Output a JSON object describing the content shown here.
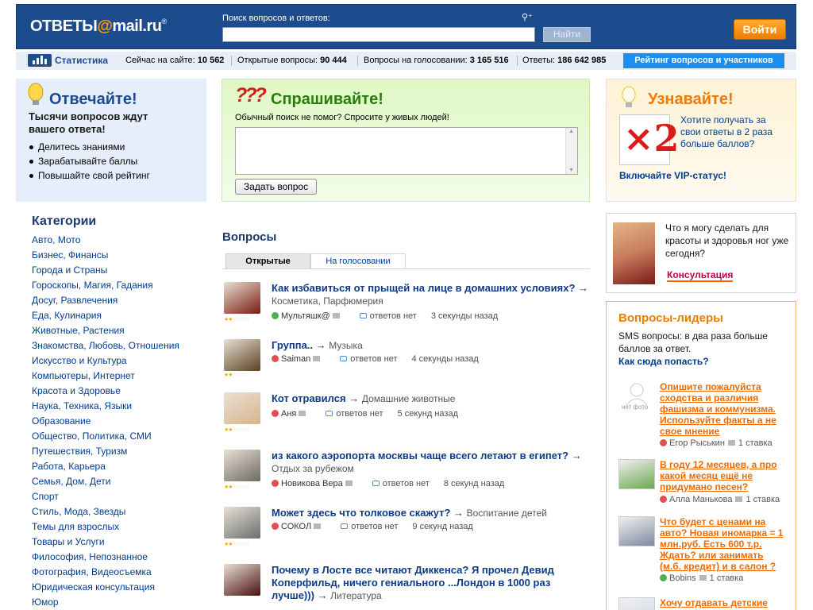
{
  "header": {
    "logo_main": "ОТВЕТЫ",
    "logo_at": "@",
    "logo_mail": "mail.ru",
    "logo_reg": "®",
    "search_label": "Поиск вопросов и ответов:",
    "search_value": "",
    "search_button": "Найти",
    "login_button": "Войти",
    "search_tools_glyph": "⚲⁺"
  },
  "stats": {
    "title": "Статистика",
    "online_label": "Сейчас на сайте:",
    "online_value": "10 562",
    "open_label": "Открытые вопросы:",
    "open_value": "90 444",
    "voting_label": "Вопросы на голосовании:",
    "voting_value": "3 165 516",
    "answers_label": "Ответы:",
    "answers_value": "186 642 985",
    "rating_prefix": "Рейтинг",
    "rating_questions": "вопросов",
    "rating_and": "и",
    "rating_users": "участников"
  },
  "promo_answer": {
    "title": "Отвечайте!",
    "subtitle": "Тысячи вопросов ждут вашего ответа!",
    "items": [
      "Делитесь знаниями",
      "Зарабатывайте баллы",
      "Повышайте свой рейтинг"
    ]
  },
  "promo_ask": {
    "title": "Спрашивайте!",
    "icon_glyph": "???",
    "subtitle": "Обычный поиск не помог? Спросите у живых людей!",
    "textarea_value": "",
    "button": "Задать вопрос"
  },
  "promo_learn": {
    "title": "Узнавайте!",
    "x2_glyph": "×2",
    "link": "Хотите получать за свои ответы в 2 раза больше баллов?",
    "vip_link": "Включайте VIP-статус!"
  },
  "categories": {
    "title": "Категории",
    "items": [
      "Авто, Мото",
      "Бизнес, Финансы",
      "Города и Страны",
      "Гороскопы, Магия, Гадания",
      "Досуг, Развлечения",
      "Еда, Кулинария",
      "Животные, Растения",
      "Знакомства, Любовь, Отношения",
      "Искусство и Культура",
      "Компьютеры, Интернет",
      "Красота и Здоровье",
      "Наука, Техника, Языки",
      "Образование",
      "Общество, Политика, СМИ",
      "Путешествия, Туризм",
      "Работа, Карьера",
      "Семья, Дом, Дети",
      "Спорт",
      "Стиль, Мода, Звезды",
      "Темы для взрослых",
      "Товары и Услуги",
      "Философия, Непознанное",
      "Фотография, Видеосъемка",
      "Юридическая консультация",
      "Юмор"
    ]
  },
  "questions": {
    "title": "Вопросы",
    "tab_open": "Открытые",
    "tab_voting": "На голосовании",
    "arrow": "→",
    "items": [
      {
        "text": "Как избавиться от прыщей на лице в домашних условиях?",
        "category": "Косметика, Парфюмерия",
        "user": "Мультяшк@",
        "answers": "ответов нет",
        "time": "3 секунды назад",
        "stars": "★★☆☆☆☆",
        "user_color": "#4caf50",
        "avatar_color": "#7a1a10"
      },
      {
        "text": "Группа..",
        "category": "Музыка",
        "user": "Saiman",
        "answers": "ответов нет",
        "time": "4 секунды назад",
        "stars": "★★☆☆☆☆",
        "user_color": "#e05050",
        "avatar_color": "#5a4020"
      },
      {
        "text": "Кот отравился",
        "category": "Домашние животные",
        "user": "Аня",
        "answers": "ответов нет",
        "time": "5 секунд назад",
        "stars": "★★☆☆☆☆",
        "user_color": "#e05050",
        "avatar_color": "#d8b48c"
      },
      {
        "text": "из какого аэропорта москвы чаще всего летают в египет?",
        "category": "Отдых за рубежом",
        "user": "Новикова Вера",
        "answers": "ответов нет",
        "time": "8 секунд назад",
        "stars": "★★☆☆☆☆",
        "user_color": "#e05050",
        "avatar_color": "#6d6a64"
      },
      {
        "text": "Может здесь что толковое скажут?",
        "category": "Воспитание детей",
        "user": "СОКОЛ",
        "answers": "ответов нет",
        "time": "9 секунд назад",
        "stars": "★★☆☆☆☆",
        "user_color": "#e05050",
        "avatar_color": "#6a6e70"
      },
      {
        "text": "Почему в Лосте все читают Диккенса? Я прочел Девид Коперфильд, ничего гениального ...Лондон в 1000 раз лучше)))",
        "category": "Литература",
        "user": "",
        "answers": "",
        "time": "",
        "stars": "",
        "user_color": "#e05050",
        "avatar_color": "#4a1010"
      }
    ]
  },
  "consult": {
    "text": "Что я могу сделать для красоты и здоровья ног уже сегодня?",
    "link": "Консультация"
  },
  "leaders": {
    "title": "Вопросы-лидеры",
    "subtitle": "SMS вопросы: в два раза больше баллов за ответ.",
    "link": "Как сюда попасть?",
    "nophoto": "нет фото",
    "items": [
      {
        "text": "Опишите пожалуйста сходства и различия фашизма и коммунизма. Используйте факты а не свое мнение",
        "user": "Егор Рыськин",
        "bid": "1 ставка",
        "photo": "none",
        "user_color": "#e05050"
      },
      {
        "text": "В году 12 месяцев, а про какой месяц ещё не придумано песен?",
        "user": "Алла Манькова",
        "bid": "1 ставка",
        "photo": "#6aa84f",
        "user_color": "#e05050"
      },
      {
        "text": "Что будет с ценами на авто? Новая иномарка = 1 млн.руб. Есть 600 т.р. Ждать? или занимать (м.б. кредит) и в салон ?",
        "user": "Bobins",
        "bid": "1 ставка",
        "photo": "#7d8aa0",
        "user_color": "#4caf50"
      },
      {
        "text": "Хочу отдавать детские",
        "user": "",
        "bid": "",
        "photo": "#cfd6df",
        "user_color": "#e05050"
      }
    ]
  }
}
